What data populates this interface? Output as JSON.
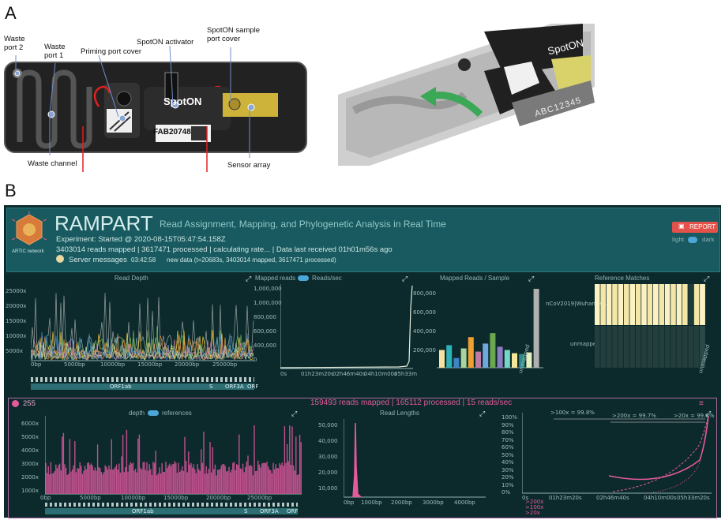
{
  "panel_a_label": "A",
  "panel_b_label": "B",
  "flowcell": {
    "labels": {
      "waste_port_2": "Waste\nport 2",
      "waste_port_1": "Waste\nport 1",
      "priming_port_cover": "Priming port cover",
      "spoton_activator": "SpotON activator",
      "spoton_sample_port_cover": "SpotON sample\nport cover",
      "waste_channel": "Waste channel",
      "sensor_array": "Sensor array"
    },
    "spoton_text": "SpotON",
    "id_text": "FAB20748",
    "closeup_serial": "ABC12345",
    "closeup_spoton": "SpotON"
  },
  "rampart": {
    "logo_text": "ARTIC network",
    "title": "RAMPART",
    "subtitle": "Read Assignment, Mapping, and Phylogenetic Analysis in Real Time",
    "experiment_line": "Experiment: Started @ 2020-08-15T05:47:54.158Z",
    "status_line": "3403014 reads mapped | 3617471 processed | calculating rate... | Data last received 01h01m56s ago",
    "server_messages_label": "Server messages",
    "server_time": "03:42:58",
    "server_msg": "new data (t=20683s, 3403014 mapped, 3617471 processed)",
    "report_button": "REPORT",
    "theme_light": "light",
    "theme_dark": "dark",
    "colors": {
      "accent_pink": "#e55a9c",
      "report_red": "#e2524a",
      "panel_bg": "#0c2a2c",
      "header_bg": "#185a5f"
    },
    "top_charts": {
      "read_depth": {
        "title": "Read Depth",
        "y_ticks": [
          "25000x",
          "20000x",
          "15000x",
          "10000x",
          "5000x"
        ],
        "x_ticks": [
          "0bp",
          "5000bp",
          "10000bp",
          "15000bp",
          "20000bp",
          "25000bp"
        ],
        "genes": [
          "ORF1ab",
          "S",
          "ORF3A",
          "ORF"
        ]
      },
      "mapped_reads": {
        "title_left": "Mapped reads",
        "title_right": "Reads/sec",
        "y_ticks": [
          "1,000,000",
          "1,000,000",
          "800,000",
          "600,000",
          "400,000",
          "200,000",
          "0"
        ],
        "x_ticks": [
          "0s",
          "01h23m20s",
          "02h46m40s",
          "04h10m00s",
          "05h33m"
        ]
      },
      "mapped_per_sample": {
        "title": "Mapped Reads / Sample",
        "y_ticks": [
          "800,000",
          "600,000",
          "400,000",
          "200,000"
        ],
        "last_category": "unmapped"
      },
      "reference_matches": {
        "title": "Reference Matches",
        "row_labels": [
          "nCoV2019|Wuhan-H...",
          "unmapped"
        ],
        "last_column": "unmapped"
      }
    },
    "bottom": {
      "sample_count": "255",
      "summary": "159493 reads mapped | 165112 processed | 15 reads/sec",
      "depth_toggle_left": "depth",
      "depth_toggle_right": "references",
      "depth_y_ticks": [
        "6000x",
        "5000x",
        "4000x",
        "3000x",
        "2000x",
        "1000x"
      ],
      "depth_x_ticks": [
        "0bp",
        "5000bp",
        "10000bp",
        "15000bp",
        "20000bp",
        "25000bp"
      ],
      "genes": [
        "ORF1ab",
        "S",
        "ORF3A",
        "ORF"
      ],
      "read_lengths_title": "Read Lengths",
      "rl_y_ticks": [
        "50,000",
        "40,000",
        "30,000",
        "20,000",
        "10,000"
      ],
      "rl_x_ticks": [
        "0bp",
        "1000bp",
        "2000bp",
        "3000bp",
        "4000bp"
      ],
      "cov_y_ticks": [
        "100%",
        "90%",
        "80%",
        "70%",
        "60%",
        "50%",
        "40%",
        "30%",
        "20%",
        "10%",
        "0%"
      ],
      "cov_x_ticks": [
        "0s",
        "01h23m20s",
        "02h46m40s",
        "04h10m00s",
        "05h33m20s"
      ],
      "cov_annotations": [
        ">100x = 99.8%",
        ">200x = 99.7%",
        ">20x = 99.8%"
      ],
      "legend": [
        ">200x",
        ">100x",
        ">20x"
      ]
    }
  }
}
